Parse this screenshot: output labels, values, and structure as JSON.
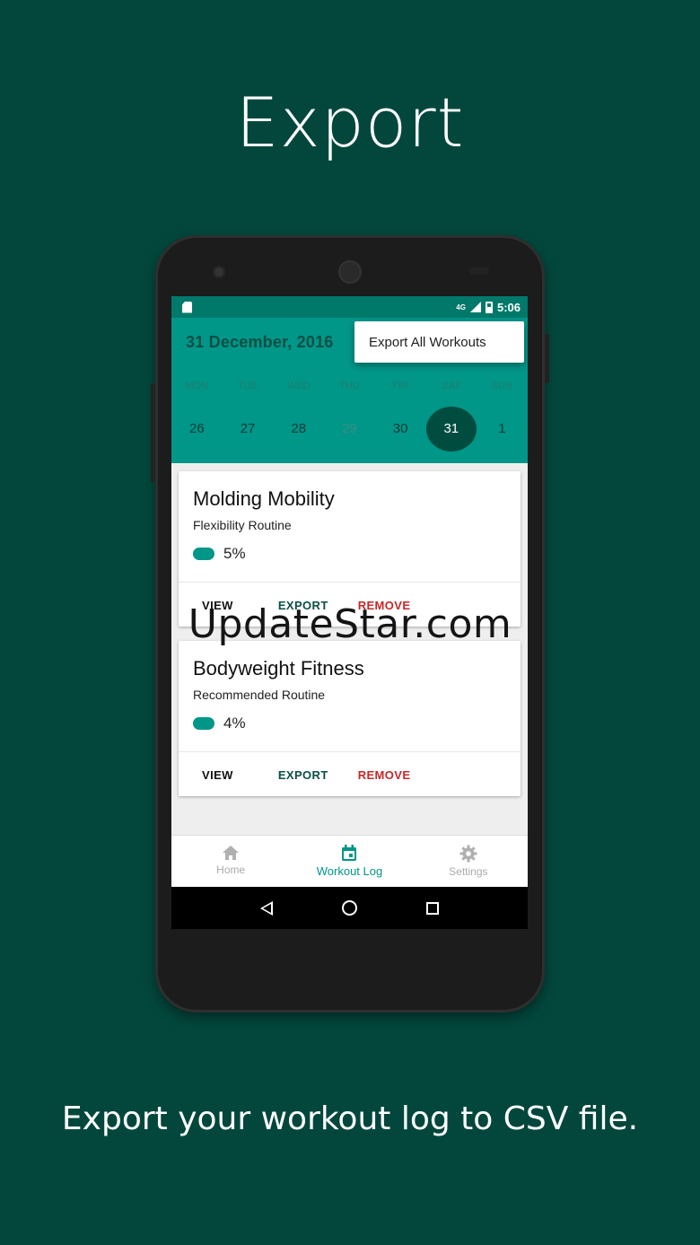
{
  "headline": "Export",
  "caption": "Export your workout log to CSV file.",
  "watermark": "UpdateStar.com",
  "status_bar": {
    "time": "5:06",
    "network": "4G"
  },
  "app_bar": {
    "date_title": "31 December, 2016",
    "menu": {
      "items": [
        "Export All Workouts"
      ]
    },
    "weekdays": [
      "MON",
      "TUE",
      "WED",
      "THU",
      "FRI",
      "SAT",
      "SUN"
    ],
    "days": [
      "26",
      "27",
      "28",
      "29",
      "30",
      "31",
      "1"
    ],
    "selected_day": "31"
  },
  "workouts": [
    {
      "title": "Molding Mobility",
      "subtitle": "Flexibility Routine",
      "progress": "5%",
      "actions": {
        "view": "VIEW",
        "export": "EXPORT",
        "remove": "REMOVE"
      }
    },
    {
      "title": "Bodyweight Fitness",
      "subtitle": "Recommended Routine",
      "progress": "4%",
      "actions": {
        "view": "VIEW",
        "export": "EXPORT",
        "remove": "REMOVE"
      }
    }
  ],
  "bottom_nav": {
    "items": [
      {
        "label": "Home",
        "icon": "home-icon"
      },
      {
        "label": "Workout Log",
        "icon": "calendar-icon"
      },
      {
        "label": "Settings",
        "icon": "gear-icon"
      }
    ],
    "active": "Workout Log"
  },
  "colors": {
    "background": "#03473c",
    "primary": "#009688",
    "primary_dark": "#004d40",
    "remove": "#c62828"
  }
}
